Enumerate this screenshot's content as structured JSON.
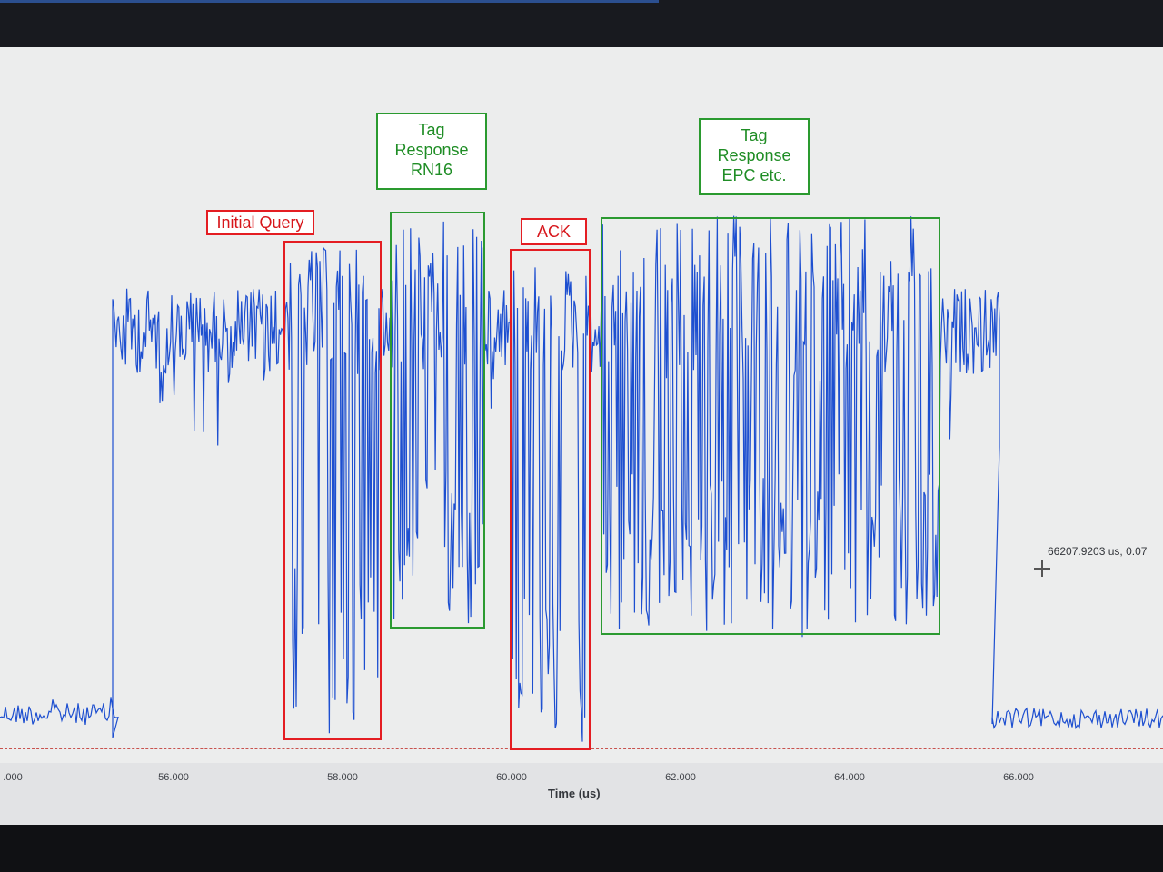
{
  "app": {
    "colors": {
      "signal": "#1d4fd0",
      "annotation_red": "#e41d22",
      "annotation_green": "#2a9a2f",
      "plot_background": "#eceded"
    }
  },
  "annotations": {
    "initial_query": "Initial Query",
    "tag_response_rn16": [
      "Tag",
      "Response",
      "RN16"
    ],
    "ack": "ACK",
    "tag_response_epc": [
      "Tag",
      "Response",
      "EPC etc."
    ]
  },
  "cursor": {
    "readout": "66207.9203 us, 0.07",
    "icon": "crosshair-icon"
  },
  "x_axis": {
    "title": "Time (us)",
    "ticks": [
      ".000",
      "56.000",
      "58.000",
      "60.000",
      "62.000",
      "64.000",
      "66.000"
    ]
  }
}
